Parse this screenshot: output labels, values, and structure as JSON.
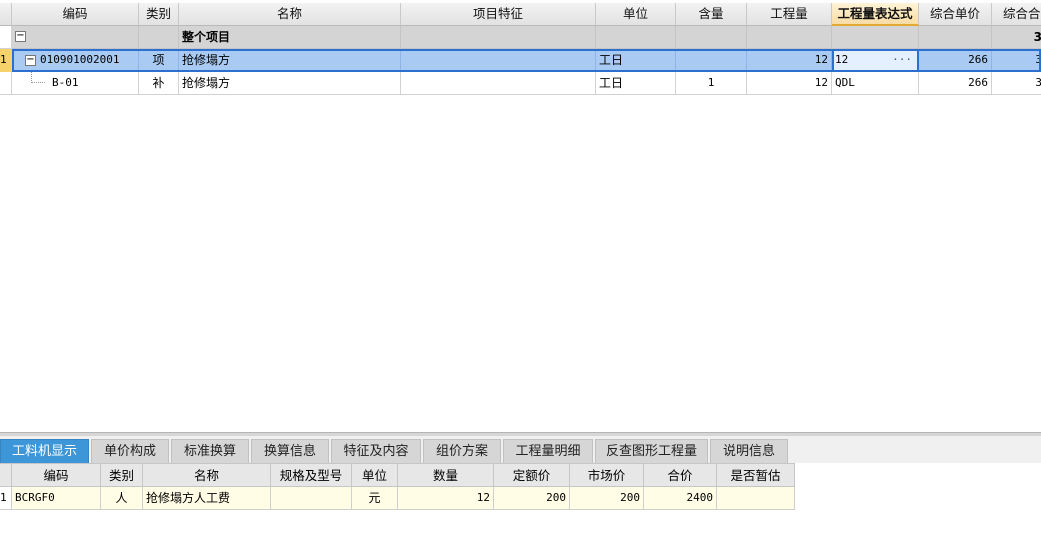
{
  "grid": {
    "columns": [
      "编码",
      "类别",
      "名称",
      "项目特征",
      "单位",
      "含量",
      "工程量",
      "工程量表达式",
      "综合单价",
      "综合合价"
    ],
    "active_column": "工程量表达式",
    "rows": [
      {
        "toggle": "−",
        "code": "",
        "type": "",
        "name": "整个项目",
        "feature": "",
        "unit": "",
        "content": "",
        "qty": "",
        "expr": "",
        "unit_price": "",
        "total": "3"
      },
      {
        "marker": "1",
        "toggle": "−",
        "code": "010901002001",
        "type": "项",
        "name": "抢修塌方",
        "feature": "",
        "unit": "工日",
        "content": "",
        "qty": "12",
        "expr": "12",
        "expr_btn": "···",
        "unit_price": "266",
        "total": "3"
      },
      {
        "code": "B-01",
        "type": "补",
        "name": "抢修塌方",
        "feature": "",
        "unit": "工日",
        "content": "1",
        "qty": "12",
        "expr": "QDL",
        "unit_price": "266",
        "total": "3"
      }
    ]
  },
  "bottom": {
    "tabs": [
      "工料机显示",
      "单价构成",
      "标准换算",
      "换算信息",
      "特征及内容",
      "组价方案",
      "工程量明细",
      "反查图形工程量",
      "说明信息"
    ],
    "active_tab": "工料机显示",
    "columns": [
      "编码",
      "类别",
      "名称",
      "规格及型号",
      "单位",
      "数量",
      "定额价",
      "市场价",
      "合价",
      "是否暂估"
    ],
    "rows": [
      {
        "marker": "1",
        "code": "BCRGF0",
        "type": "人",
        "name": "抢修塌方人工费",
        "spec": "",
        "unit": "元",
        "qty": "12",
        "quota_price": "200",
        "market_price": "200",
        "total": "2400",
        "estimated": ""
      }
    ]
  },
  "colors": {
    "selected_row": "#a9cbf3",
    "section_row": "#d4d4d4",
    "active_tab": "#3d96d8",
    "active_header": "#f8dca4",
    "detail_row": "#fffde6"
  }
}
